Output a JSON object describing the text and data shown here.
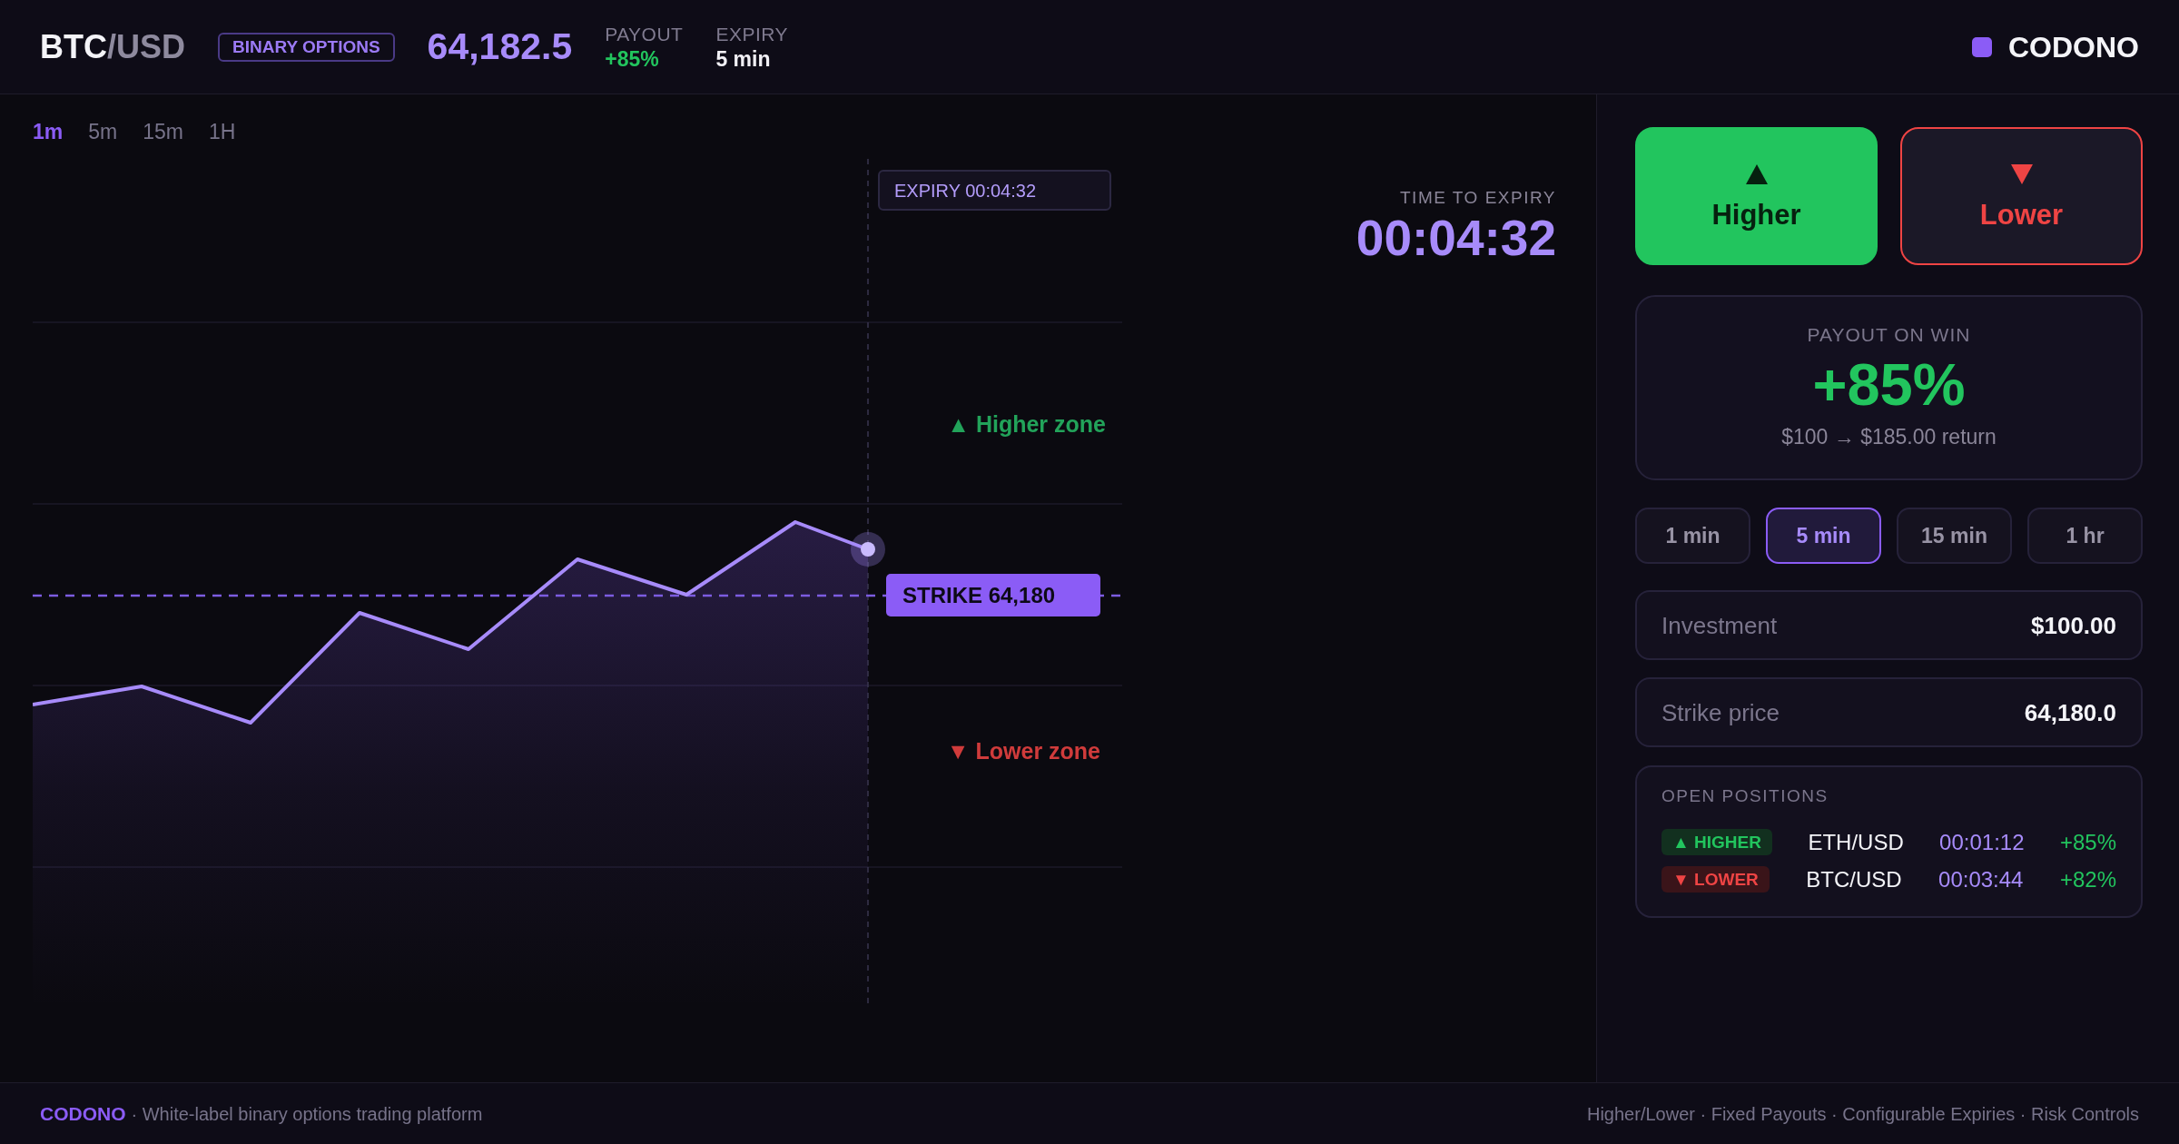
{
  "header": {
    "symbol": {
      "base": "BTC",
      "quote": "/USD"
    },
    "badge": "BINARY OPTIONS",
    "price": "64,182.5",
    "stats": [
      {
        "label": "PAYOUT",
        "value": "+85%",
        "kind": "positive"
      },
      {
        "label": "EXPIRY",
        "value": "5 min",
        "kind": "neutral"
      }
    ],
    "brand": "CODONO"
  },
  "chart": {
    "timeframes": [
      {
        "label": "1m",
        "selected": true
      },
      {
        "label": "5m",
        "selected": false
      },
      {
        "label": "15m",
        "selected": false
      },
      {
        "label": "1H",
        "selected": false
      }
    ],
    "expiry_marker": "EXPIRY 00:04:32",
    "zones": [
      {
        "label": "▲ Higher zone",
        "kind": "higher"
      },
      {
        "label": "▼ Lower zone",
        "kind": "lower"
      }
    ],
    "strike_label": "STRIKE 64,180",
    "countdown": {
      "label": "TIME TO EXPIRY",
      "value": "00:04:32"
    }
  },
  "trade_panel": {
    "directions": [
      {
        "label": "Higher",
        "kind": "higher",
        "selected": true
      },
      {
        "label": "Lower",
        "kind": "lower",
        "selected": false
      }
    ],
    "payout": {
      "label": "PAYOUT ON WIN",
      "value": "+85%",
      "return_text": "$100 → $185.00 return"
    },
    "expiry_options": [
      {
        "label": "1 min",
        "selected": false
      },
      {
        "label": "5 min",
        "selected": true
      },
      {
        "label": "15 min",
        "selected": false
      },
      {
        "label": "1 hr",
        "selected": false
      }
    ],
    "fields": [
      {
        "label": "Investment",
        "value": "$100.00"
      },
      {
        "label": "Strike price",
        "value": "64,180.0"
      }
    ],
    "open_positions": {
      "title": "OPEN POSITIONS",
      "rows": [
        {
          "direction": "▲ HIGHER",
          "kind": "higher",
          "pair": "ETH/USD",
          "time_left": "00:01:12",
          "payout": "+85%"
        },
        {
          "direction": "▼ LOWER",
          "kind": "lower",
          "pair": "BTC/USD",
          "time_left": "00:03:44",
          "payout": "+82%"
        }
      ]
    }
  },
  "footer": {
    "brand": "CODONO",
    "tagline": "· White-label binary options trading platform",
    "features": "Higher/Lower · Fixed Payouts · Configurable Expiries · Risk Controls"
  }
}
